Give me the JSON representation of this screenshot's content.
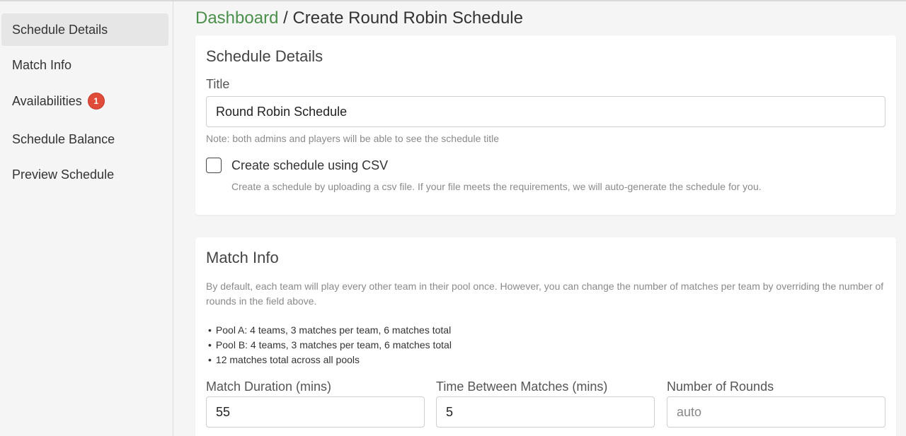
{
  "sidebar": {
    "items": [
      {
        "label": "Schedule Details"
      },
      {
        "label": "Match Info"
      },
      {
        "label": "Availabilities",
        "badge": "1"
      },
      {
        "label": "Schedule Balance"
      },
      {
        "label": "Preview Schedule"
      }
    ]
  },
  "breadcrumb": {
    "link": "Dashboard",
    "separator": " / ",
    "current": "Create Round Robin Schedule"
  },
  "schedule_details": {
    "title": "Schedule Details",
    "title_label": "Title",
    "title_value": "Round Robin Schedule",
    "title_note": "Note: both admins and players will be able to see the schedule title",
    "csv_label": "Create schedule using CSV",
    "csv_checked": false,
    "csv_note": "Create a schedule by uploading a csv file. If your file meets the requirements, we will auto-generate the schedule for you."
  },
  "match_info": {
    "title": "Match Info",
    "description": "By default, each team will play every other team in their pool once. However, you can change the number of matches per team by overriding the number of rounds in the field above.",
    "bullets": [
      "Pool A: 4 teams, 3 matches per team, 6 matches total",
      "Pool B: 4 teams, 3 matches per team, 6 matches total",
      "12 matches total across all pools"
    ],
    "fields": [
      {
        "label": "Match Duration (mins)",
        "value": "55",
        "placeholder": ""
      },
      {
        "label": "Time Between Matches (mins)",
        "value": "5",
        "placeholder": ""
      },
      {
        "label": "Number of Rounds",
        "value": "",
        "placeholder": "auto"
      }
    ]
  },
  "colors": {
    "accent_green": "#4a8f4a",
    "badge_red": "#e04b3a",
    "active_nav_bg": "#e6e6e6"
  }
}
